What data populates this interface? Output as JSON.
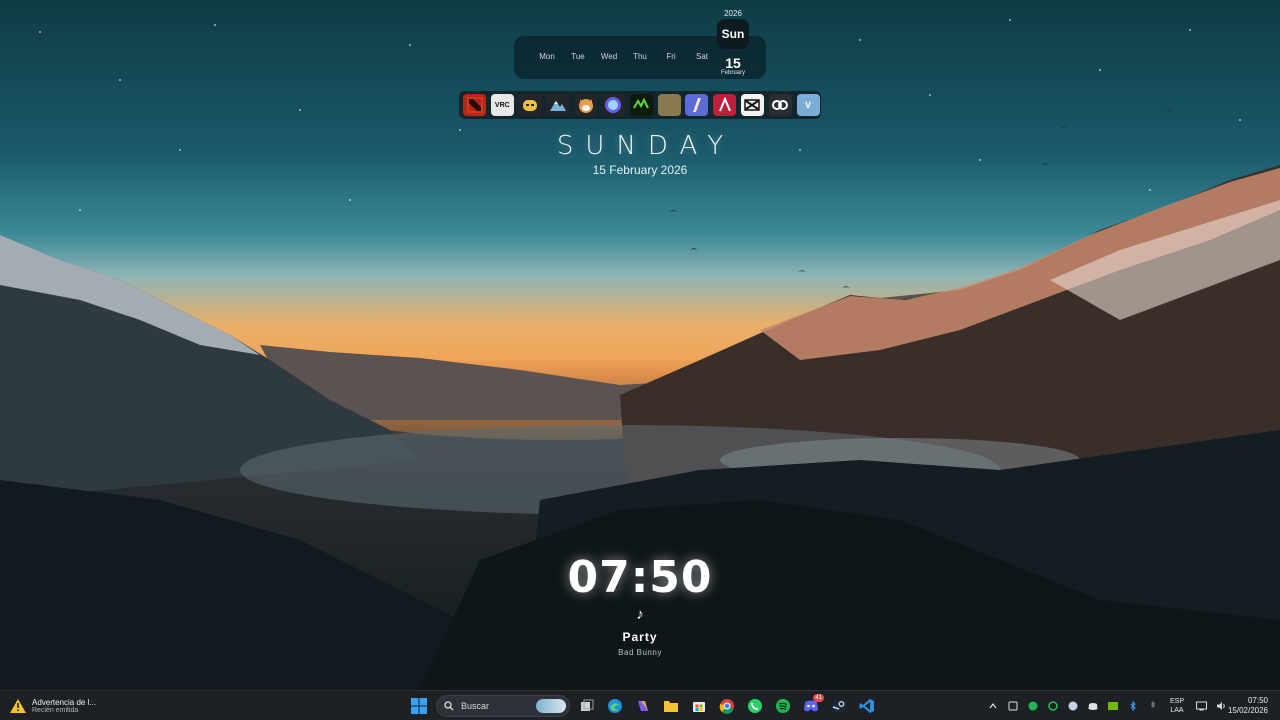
{
  "calendar": {
    "year": "2026",
    "weekdays": [
      "Mon",
      "Tue",
      "Wed",
      "Thu",
      "Fri",
      "Sat"
    ],
    "today_day": "Sun",
    "today_date": "15",
    "today_month": "February"
  },
  "dock": {
    "apps": [
      {
        "name": "dota2",
        "glyph": "",
        "color": "#b52818"
      },
      {
        "name": "vrchat",
        "glyph": "VRC",
        "color": "#e8e8e8"
      },
      {
        "name": "ai-assistant",
        "glyph": "",
        "color": "#f2c33a"
      },
      {
        "name": "mountain-app",
        "glyph": "",
        "color": "#6ea6cf"
      },
      {
        "name": "shiba-app",
        "glyph": "",
        "color": "#e89b4a"
      },
      {
        "name": "globe-app",
        "glyph": "",
        "color": "#6b5cf0"
      },
      {
        "name": "nvidia-app",
        "glyph": "",
        "color": "#2f6a1e"
      },
      {
        "name": "game-app",
        "glyph": "",
        "color": "#8a7a52"
      },
      {
        "name": "osu-app",
        "glyph": "",
        "color": "#5a6bd6"
      },
      {
        "name": "affinity-app",
        "glyph": "",
        "color": "#c01f3b"
      },
      {
        "name": "capcut-app",
        "glyph": "",
        "color": "#f3f3f3"
      },
      {
        "name": "link-app",
        "glyph": "",
        "color": "#2a2d31"
      },
      {
        "name": "vegas-app",
        "glyph": "V",
        "color": "#7aaed6"
      }
    ]
  },
  "day": {
    "name": "SUNDAY",
    "full_date": "15 February 2026"
  },
  "clock": {
    "time": "07:50"
  },
  "media": {
    "note_icon": "♪",
    "song": "Party",
    "artist": "Bad Bunny"
  },
  "taskbar": {
    "notification_title": "Advertencia de l...",
    "notification_subtitle": "Recién emitida",
    "search_placeholder": "Buscar",
    "whatsapp_badge": "",
    "discord_badge": "41",
    "language_top": "ESP",
    "language_bottom": "LAA",
    "time": "07:50",
    "date": "15/02/2026"
  },
  "colors": {
    "accent_windows": "#3aa0f3",
    "taskbar_bg": "#1d2024"
  }
}
